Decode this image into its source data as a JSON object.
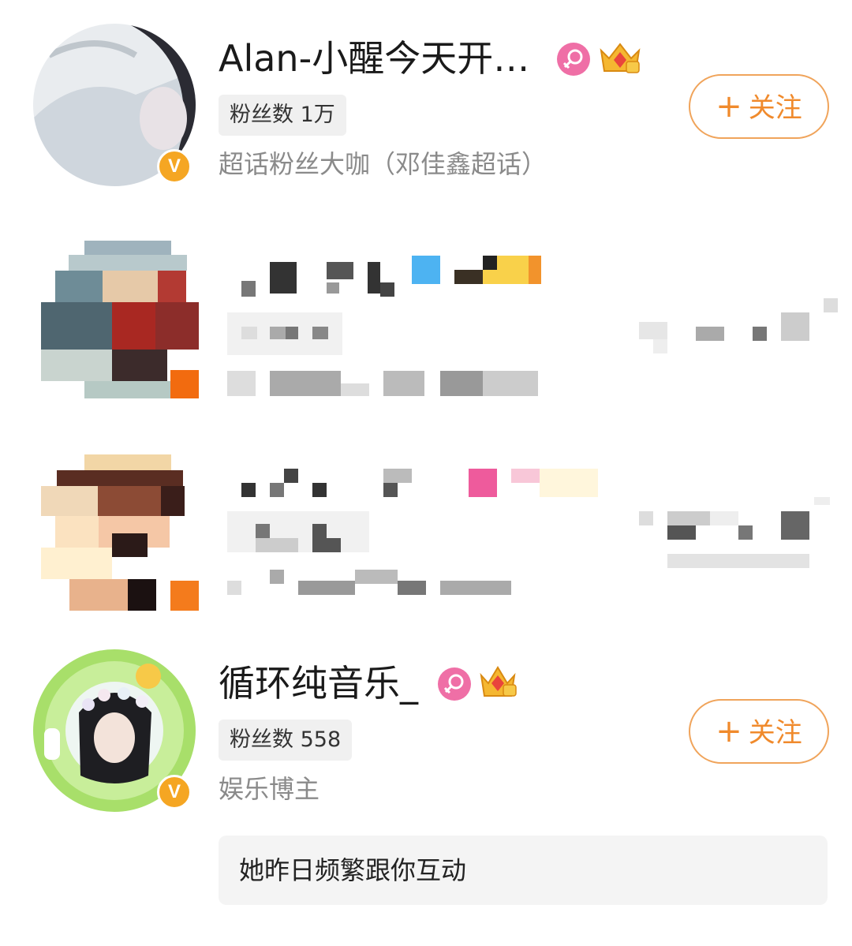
{
  "users": [
    {
      "name": "Alan-小醒今天开…",
      "fans": "粉丝数 1万",
      "description": "超话粉丝大咖（邓佳鑫超话）",
      "follow_label": "关注",
      "follow_plus": "+",
      "verified_mark": "V",
      "icons": [
        "female-icon",
        "crown-badge-icon"
      ]
    },
    {
      "blurred": true
    },
    {
      "blurred": true
    },
    {
      "name": "循环纯音乐_",
      "fans": "粉丝数 558",
      "description": "娱乐博主",
      "follow_label": "关注",
      "follow_plus": "+",
      "verified_mark": "V",
      "icons": [
        "female-icon",
        "crown-badge-icon"
      ]
    }
  ],
  "hint": "她昨日频繁跟你互动",
  "colors": {
    "accent": "#f08a2c",
    "badge_pink": "#ef6fa6",
    "verified": "#f5a623",
    "muted_text": "#8a8a8a",
    "chip_bg": "#f0f0f0"
  }
}
